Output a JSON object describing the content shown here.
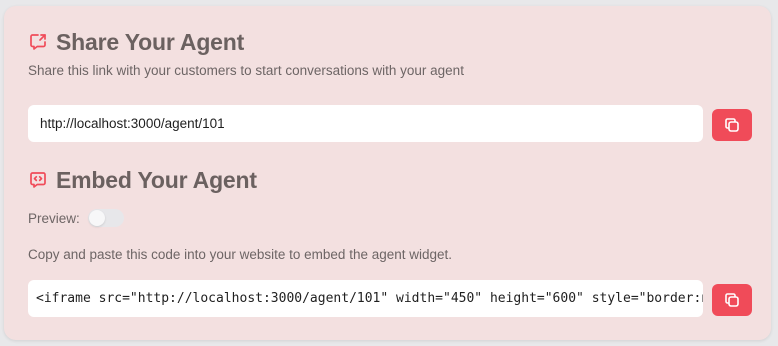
{
  "share": {
    "title": "Share Your Agent",
    "description": "Share this link with your customers to start conversations with your agent",
    "link_value": "http://localhost:3000/agent/101",
    "icon": "share-message-icon"
  },
  "embed": {
    "title": "Embed Your Agent",
    "preview_label": "Preview:",
    "preview_enabled": false,
    "description": "Copy and paste this code into your website to embed the agent widget.",
    "code_value": "<iframe src=\"http://localhost:3000/agent/101\" width=\"450\" height=\"600\" style=\"border:none;\"></iframe>",
    "icon": "code-message-icon"
  },
  "colors": {
    "card_background": "#f3e0e0",
    "accent": "#f04b59",
    "title_text": "#6b6160"
  }
}
